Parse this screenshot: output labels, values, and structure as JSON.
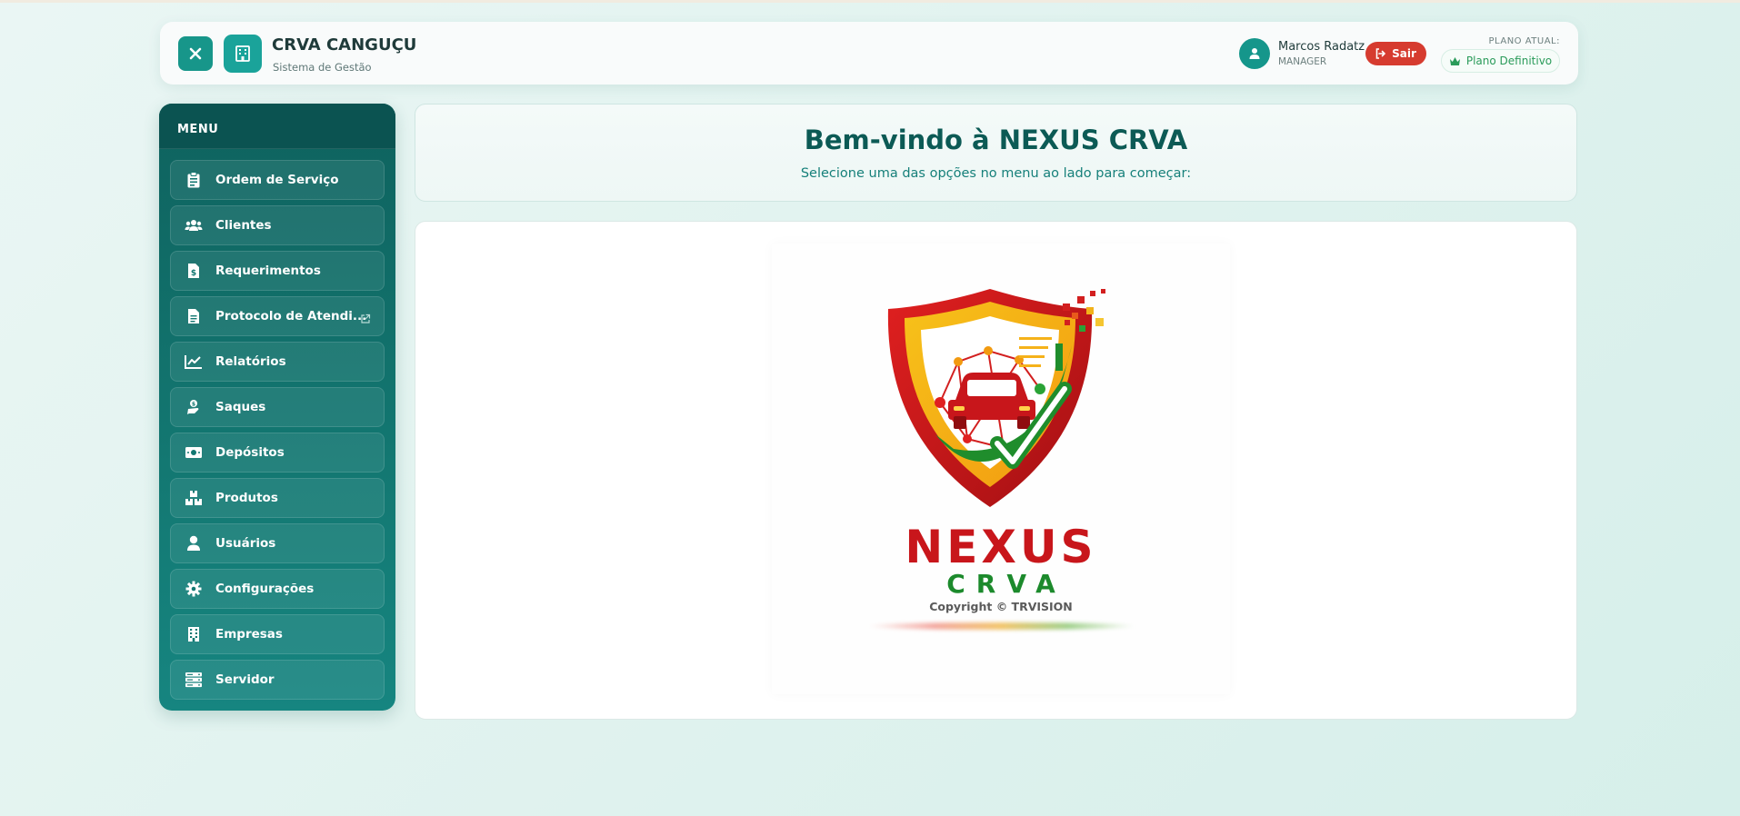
{
  "header": {
    "org_name": "CRVA CANGUÇU",
    "org_subtitle": "Sistema de Gestão",
    "user_name": "Marcos Radatz",
    "user_role": "MANAGER",
    "logout_label": "Sair",
    "plan_label": "PLANO ATUAL:",
    "plan_name": "Plano Definitivo"
  },
  "sidebar": {
    "title": "MENU",
    "items": [
      {
        "label": "Ordem de Serviço",
        "icon": "clipboard-list-icon"
      },
      {
        "label": "Clientes",
        "icon": "users-icon"
      },
      {
        "label": "Requerimentos",
        "icon": "file-invoice-dollar-icon"
      },
      {
        "label": "Protocolo de Atendi...",
        "icon": "file-text-icon"
      },
      {
        "label": "Relatórios",
        "icon": "line-chart-icon"
      },
      {
        "label": "Saques",
        "icon": "hand-coins-icon"
      },
      {
        "label": "Depósitos",
        "icon": "money-bill-icon"
      },
      {
        "label": "Produtos",
        "icon": "boxes-icon"
      },
      {
        "label": "Usuários",
        "icon": "user-icon"
      },
      {
        "label": "Configurações",
        "icon": "gear-icon"
      },
      {
        "label": "Empresas",
        "icon": "building-icon"
      },
      {
        "label": "Servidor",
        "icon": "server-icon"
      }
    ]
  },
  "welcome": {
    "title": "Bem-vindo à NEXUS CRVA",
    "subtitle": "Selecione uma das opções no menu ao lado para começar:"
  },
  "logo": {
    "brand_main": "NEXUS",
    "brand_sub": "CRVA",
    "copyright": "Copyright © TRVISION"
  },
  "colors": {
    "accent": "#17968a",
    "sidebar": "#0e625e",
    "danger": "#d63b2f",
    "plan_green": "#2a9b5a"
  }
}
